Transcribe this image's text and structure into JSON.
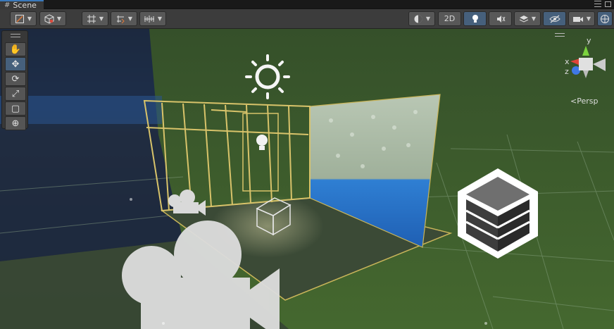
{
  "tab": {
    "title": "Scene",
    "icon": "hash-icon"
  },
  "toolbar": {
    "draw_mode": "shaded-mode-icon",
    "render_mode": "cube-icon",
    "grid_snap": "snap-grid-icon",
    "increment_snap": "increment-snap-icon",
    "ruler": "grid-ruler-icon",
    "shading": "sphere-shading-icon",
    "mode_2d_label": "2D",
    "lighting": "bulb-icon",
    "audio": "audio-icon",
    "effects": "effects-stack-icon",
    "visibility": "eye-hidden-icon",
    "camera": "camera-icon",
    "gizmos": "gizmo-icon"
  },
  "tools": [
    {
      "name": "hand-tool",
      "glyph": "✋",
      "active": false
    },
    {
      "name": "move-tool",
      "glyph": "✥",
      "active": true
    },
    {
      "name": "rotate-tool",
      "glyph": "⟳",
      "active": false
    },
    {
      "name": "scale-tool",
      "glyph": "⤢",
      "active": false
    },
    {
      "name": "rect-tool",
      "glyph": "▢",
      "active": false
    },
    {
      "name": "transform-tool",
      "glyph": "⊕",
      "active": false
    }
  ],
  "gizmo": {
    "y_label": "y",
    "x_label": "x",
    "z_label": "z",
    "projection_label": "Persp",
    "colors": {
      "x": "#e0443a",
      "y": "#7bd23d",
      "z": "#3f78e6"
    }
  },
  "scene": {
    "floor_color": "#3f5f2e",
    "sky_color": "#254d86",
    "wall_water_color": "#2f7fd3",
    "frame_color": "#d8c36a",
    "icons": [
      "sun-icon",
      "camera-small-icon",
      "camera-large-icon",
      "terrain-box-icon",
      "probe-cube-icon",
      "spot-light-icon"
    ]
  }
}
